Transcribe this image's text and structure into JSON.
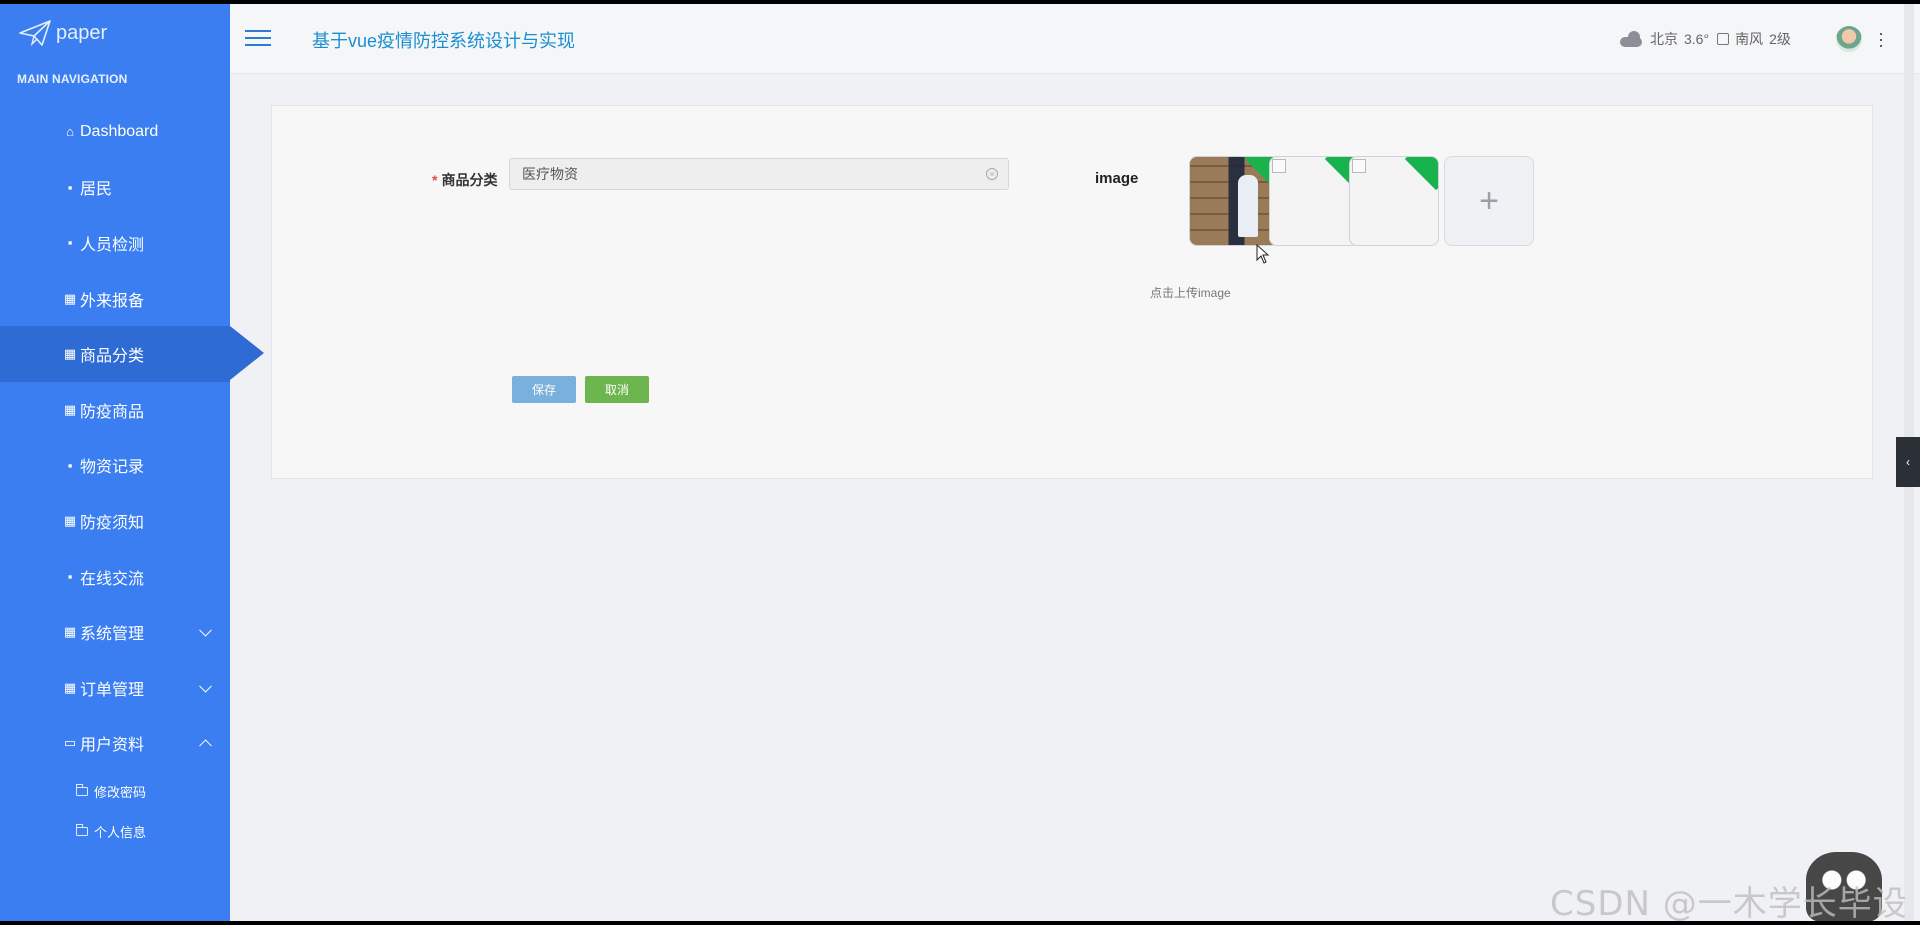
{
  "brand": {
    "name": "paper",
    "logo_icon": "paper-plane-icon"
  },
  "sidebar": {
    "heading": "MAIN NAVIGATION",
    "items": [
      {
        "label": "Dashboard",
        "icon": "home-icon",
        "glyph": "⌂"
      },
      {
        "label": "居民",
        "icon": "comment-icon",
        "glyph": "▪"
      },
      {
        "label": "人员检测",
        "icon": "briefcase-icon",
        "glyph": "▪"
      },
      {
        "label": "外来报备",
        "icon": "grid-icon",
        "glyph": "▦"
      },
      {
        "label": "商品分类",
        "icon": "grid-icon",
        "glyph": "▦",
        "active": true
      },
      {
        "label": "防疫商品",
        "icon": "apps-icon",
        "glyph": "▦"
      },
      {
        "label": "物资记录",
        "icon": "clipboard-icon",
        "glyph": "▪"
      },
      {
        "label": "防疫须知",
        "icon": "grid-icon",
        "glyph": "▦"
      },
      {
        "label": "在线交流",
        "icon": "thumbs-up-icon",
        "glyph": "▪"
      },
      {
        "label": "系统管理",
        "icon": "grid-icon",
        "glyph": "▦"
      },
      {
        "label": "订单管理",
        "icon": "grid-icon",
        "glyph": "▦"
      },
      {
        "label": "用户资料",
        "icon": "card-icon",
        "glyph": "▭"
      }
    ],
    "sub_items": [
      {
        "label": "修改密码",
        "icon": "folder-icon"
      },
      {
        "label": "个人信息",
        "icon": "folder-icon"
      }
    ]
  },
  "header": {
    "title": "基于vue疫情防控系统设计与实现",
    "weather": {
      "city": "北京",
      "temp": "3.6°",
      "wind": "南风",
      "level": "2级"
    }
  },
  "form": {
    "category_label": "商品分类",
    "required_mark": "*",
    "category_value": "医疗物资",
    "image_label": "image",
    "upload_tip": "点击上传image",
    "add_symbol": "+",
    "save_label": "保存",
    "cancel_label": "取消"
  },
  "watermark": "CSDN @一木学长毕设",
  "colors": {
    "sidebar": "#3a7ef1",
    "sidebar_active": "#2f6bd4",
    "title": "#1a8fd1",
    "save_button": "#7ab0dc",
    "cancel_button": "#6db54e",
    "upload_success": "#19b34d"
  }
}
